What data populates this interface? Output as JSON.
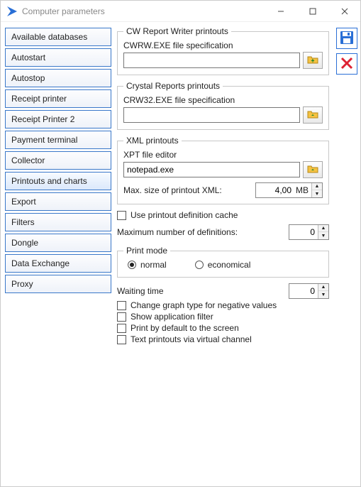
{
  "window": {
    "title": "Computer parameters"
  },
  "sidebar": {
    "items": [
      {
        "label": "Available databases"
      },
      {
        "label": "Autostart"
      },
      {
        "label": "Autostop"
      },
      {
        "label": "Receipt printer"
      },
      {
        "label": "Receipt Printer 2"
      },
      {
        "label": "Payment terminal"
      },
      {
        "label": "Collector"
      },
      {
        "label": "Printouts and charts"
      },
      {
        "label": "Export"
      },
      {
        "label": "Filters"
      },
      {
        "label": "Dongle"
      },
      {
        "label": "Data Exchange"
      },
      {
        "label": "Proxy"
      }
    ],
    "selected_index": 7
  },
  "groups": {
    "cwrw": {
      "legend": "CW Report Writer printouts",
      "spec_label": "CWRW.EXE file specification",
      "spec_value": ""
    },
    "crystal": {
      "legend": "Crystal Reports printouts",
      "spec_label": "CRW32.EXE file specification",
      "spec_value": ""
    },
    "xml": {
      "legend": "XML printouts",
      "editor_label": "XPT file editor",
      "editor_value": "notepad.exe",
      "maxsize_label": "Max. size of printout  XML:",
      "maxsize_value": "4,00",
      "maxsize_suffix": "MB"
    }
  },
  "cache": {
    "use_cache_label": "Use printout definition cache",
    "use_cache_checked": false,
    "maxdefs_label": "Maximum number of definitions:",
    "maxdefs_value": "0"
  },
  "print_mode": {
    "legend": "Print mode",
    "options": {
      "normal": "normal",
      "economical": "economical"
    },
    "selected": "normal"
  },
  "waiting": {
    "label": "Waiting time",
    "value": "0"
  },
  "checks": {
    "neg_graph": {
      "label": "Change graph type for negative values",
      "checked": false
    },
    "app_filter": {
      "label": "Show application filter",
      "checked": false
    },
    "print_screen": {
      "label": "Print by default to the screen",
      "checked": false
    },
    "virtual_channel": {
      "label": "Text printouts via virtual channel",
      "checked": false
    }
  },
  "icons": {
    "save": "save-icon",
    "cancel": "cancel-icon",
    "browse": "browse-folder-icon"
  }
}
